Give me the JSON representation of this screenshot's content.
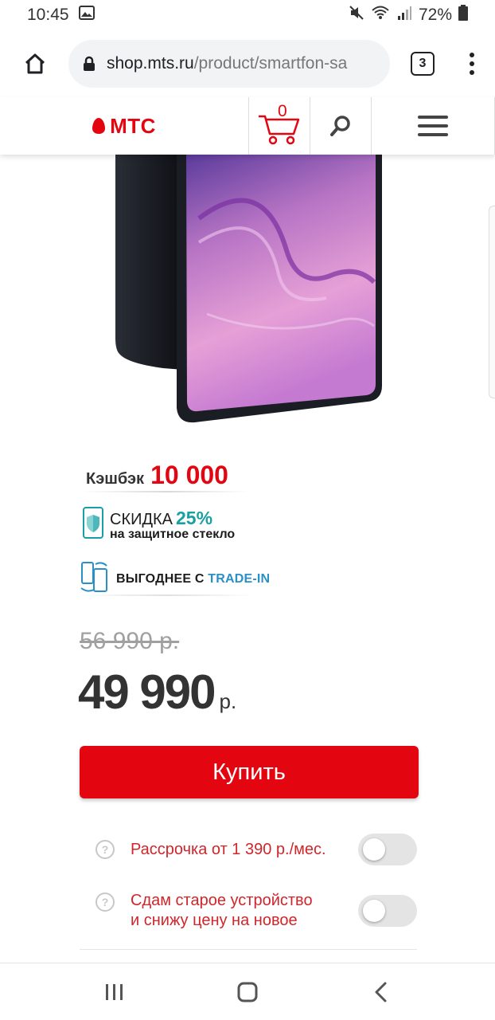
{
  "status_bar": {
    "time": "10:45",
    "battery": "72%"
  },
  "browser": {
    "url_host": "shop.mts.ru",
    "url_path": "/product/smartfon-sa",
    "tab_count": "3"
  },
  "header": {
    "logo_text": "МТС",
    "cart_count": "0"
  },
  "promos": {
    "cashback_label": "Кэшбэк",
    "cashback_value": "10 000",
    "discount_title": "СКИДКА",
    "discount_percent": "25%",
    "discount_subtitle": "на защитное стекло",
    "tradein_prefix": "ВЫГОДНЕЕ С",
    "tradein_highlight": "TRADE-IN"
  },
  "price": {
    "old": "56 990 р.",
    "new": "49 990",
    "currency": "р."
  },
  "buy_label": "Купить",
  "options": [
    {
      "label": "Рассрочка от 1 390 р./мес.",
      "enabled": false
    },
    {
      "label_line1": "Сдам старое устройство",
      "label_line2": "и снижу цену на новое",
      "enabled": false
    }
  ],
  "colors": {
    "brand_red": "#e30611",
    "discount_teal": "#1aa0a3",
    "tradein_blue": "#2b8fc7"
  }
}
